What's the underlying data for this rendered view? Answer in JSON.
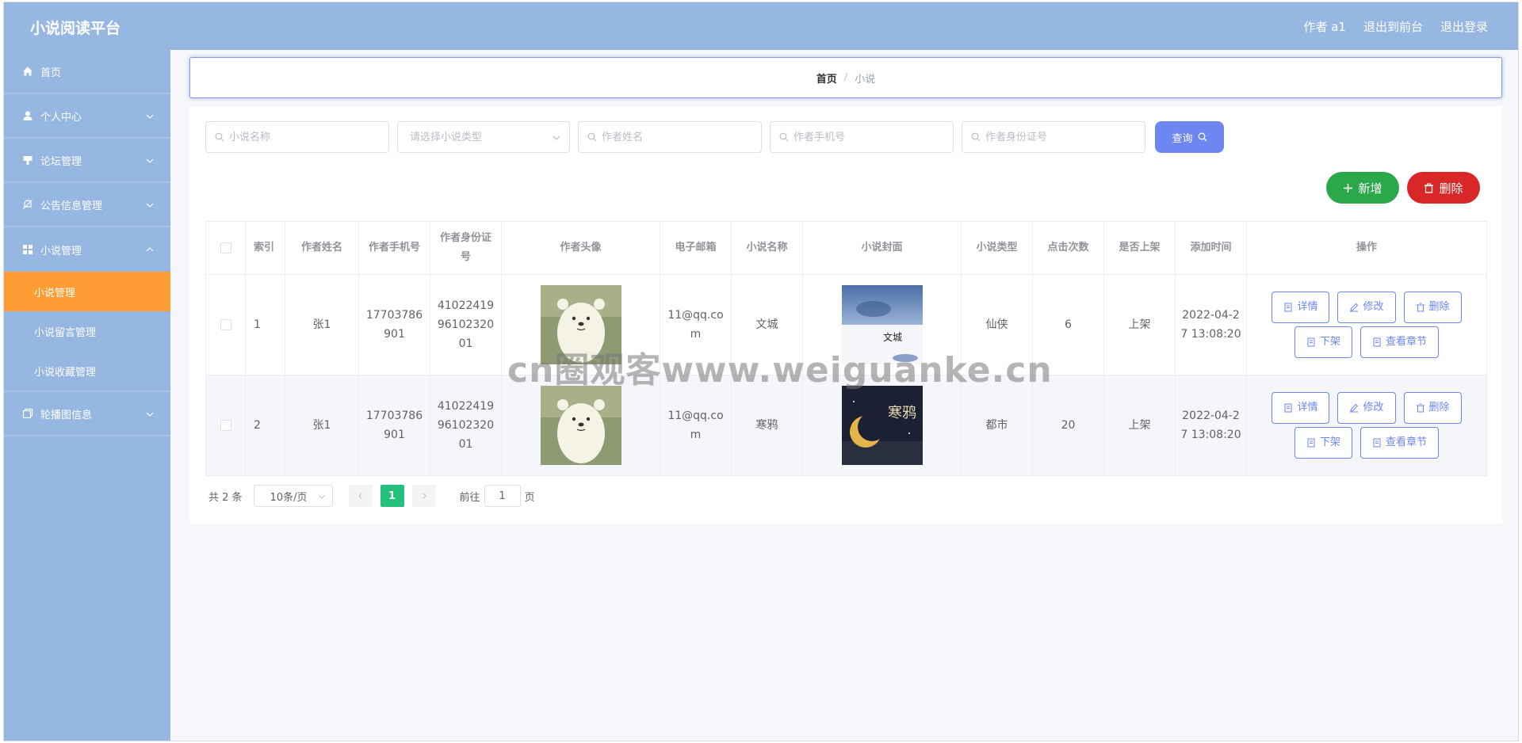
{
  "header": {
    "brand": "小说阅读平台",
    "user": "作者 a1",
    "to_front": "退出到前台",
    "logout": "退出登录"
  },
  "sidebar": {
    "items": [
      {
        "label": "首页",
        "icon": "home-icon"
      },
      {
        "label": "个人中心",
        "icon": "user-icon"
      },
      {
        "label": "论坛管理",
        "icon": "forum-icon"
      },
      {
        "label": "公告信息管理",
        "icon": "bell-off-icon"
      },
      {
        "label": "小说管理",
        "icon": "grid-icon"
      },
      {
        "label": "轮播图信息",
        "icon": "copy-icon"
      }
    ],
    "sub": [
      {
        "label": "小说管理",
        "active": true
      },
      {
        "label": "小说留言管理"
      },
      {
        "label": "小说收藏管理"
      }
    ]
  },
  "breadcrumb": {
    "home": "首页",
    "sep": "/",
    "current": "小说"
  },
  "search": {
    "name_ph": "小说名称",
    "type_ph": "请选择小说类型",
    "author_ph": "作者姓名",
    "phone_ph": "作者手机号",
    "idcard_ph": "作者身份证号",
    "query": "查询"
  },
  "actions": {
    "add": "新增",
    "delete": "删除"
  },
  "table": {
    "headers": [
      "索引",
      "作者姓名",
      "作者手机号",
      "作者身份证号",
      "作者头像",
      "电子邮箱",
      "小说名称",
      "小说封面",
      "小说类型",
      "点击次数",
      "是否上架",
      "添加时间",
      "操作"
    ],
    "rows": [
      {
        "index": "1",
        "author": "张1",
        "phone": "17703786901",
        "idcard": "410224199610232001",
        "email": "11@qq.com",
        "title": "文城",
        "type": "仙侠",
        "clicks": "6",
        "onshelf": "上架",
        "time": "2022-04-27 13:08:20",
        "cover_text": "文城"
      },
      {
        "index": "2",
        "author": "张1",
        "phone": "17703786901",
        "idcard": "410224199610232001",
        "email": "11@qq.com",
        "title": "寒鸦",
        "type": "都市",
        "clicks": "20",
        "onshelf": "上架",
        "time": "2022-04-27 13:08:20",
        "cover_text": "寒鸦"
      }
    ],
    "ops": {
      "detail": "详情",
      "edit": "修改",
      "delete": "删除",
      "offshelf": "下架",
      "chapters": "查看章节"
    }
  },
  "pagination": {
    "total": "共 2 条",
    "size": "10条/页",
    "current": "1",
    "goto": "前往",
    "page_input": "1",
    "page_unit": "页"
  },
  "watermark": "cn圈观客www.weiguanke.cn",
  "colors": {
    "header": "#96b7e2",
    "active": "#ff9d35",
    "primary": "#6c86f2",
    "add": "#2aa84a",
    "danger": "#d92627",
    "page": "#24c07e"
  }
}
